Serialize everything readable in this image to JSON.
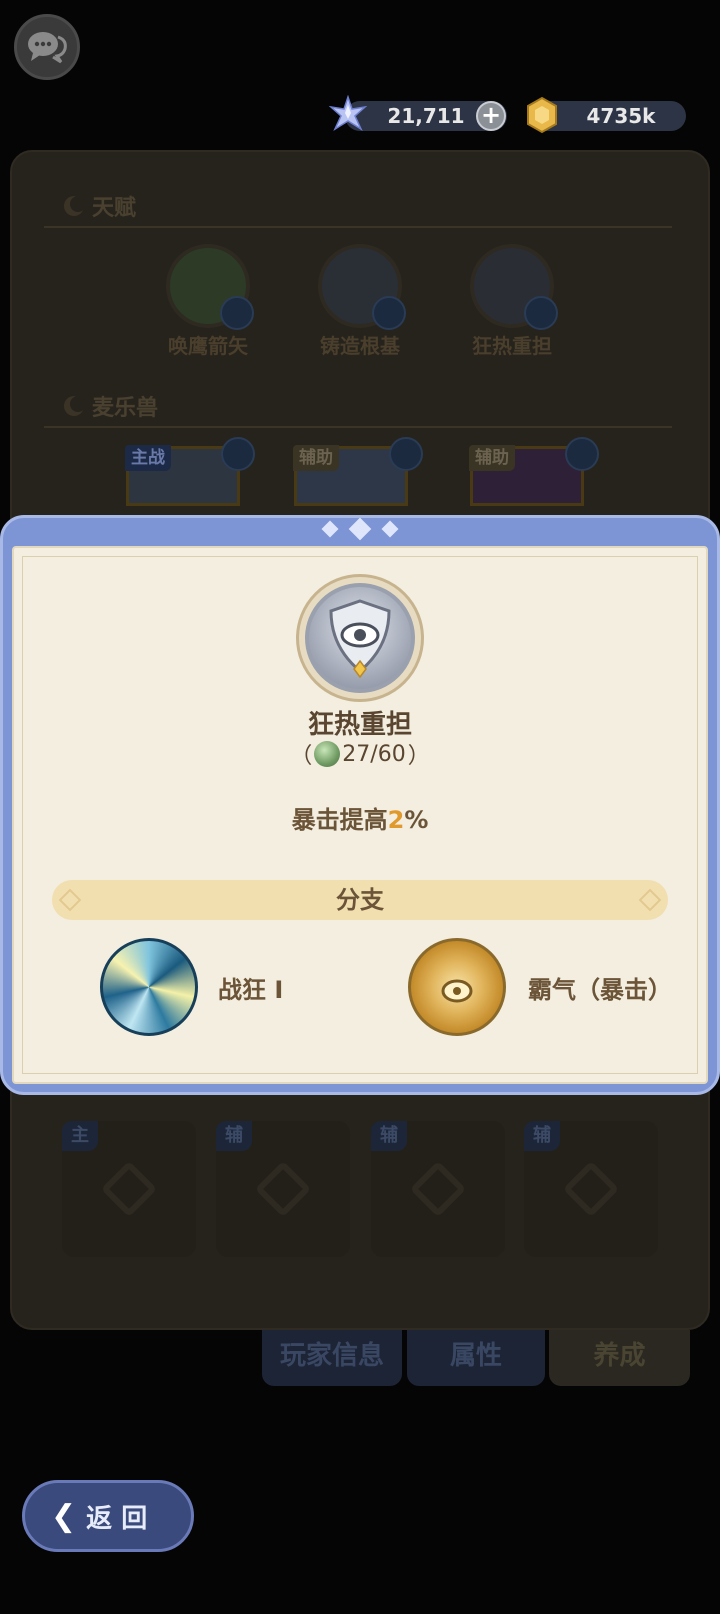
{
  "currency": {
    "gems": "21,711",
    "gold": "4735k",
    "plus": "+"
  },
  "talent_section": {
    "title": "天赋",
    "items": [
      {
        "label": "唤鹰箭矢",
        "icon": "eagle-icon"
      },
      {
        "label": "铸造根基",
        "icon": "sword-icon"
      },
      {
        "label": "狂热重担",
        "icon": "eye-shield-icon"
      }
    ]
  },
  "pet_section": {
    "title": "麦乐兽",
    "cards": [
      {
        "tag": "主战"
      },
      {
        "tag": "辅助"
      },
      {
        "tag": "辅助"
      }
    ]
  },
  "slots": [
    {
      "tag": "主"
    },
    {
      "tag": "辅"
    },
    {
      "tag": "辅"
    },
    {
      "tag": "辅"
    }
  ],
  "tabs": {
    "player_info": "玩家信息",
    "attributes": "属性",
    "cultivate": "养成"
  },
  "back_button": {
    "label": "返 回"
  },
  "modal": {
    "skill_name": "狂热重担",
    "cost_open": "（",
    "cost_value": "27/60",
    "cost_close": "）",
    "description_prefix": "暴击提高",
    "description_value": "2",
    "description_suffix": "%",
    "branch_title": "分支",
    "branches": [
      {
        "name": "战狂 I"
      },
      {
        "name": "霸气（暴击）"
      }
    ]
  },
  "colors": {
    "modal_frame": "#7d95d4",
    "modal_bg": "#f3eedf",
    "accent": "#e0992c"
  }
}
